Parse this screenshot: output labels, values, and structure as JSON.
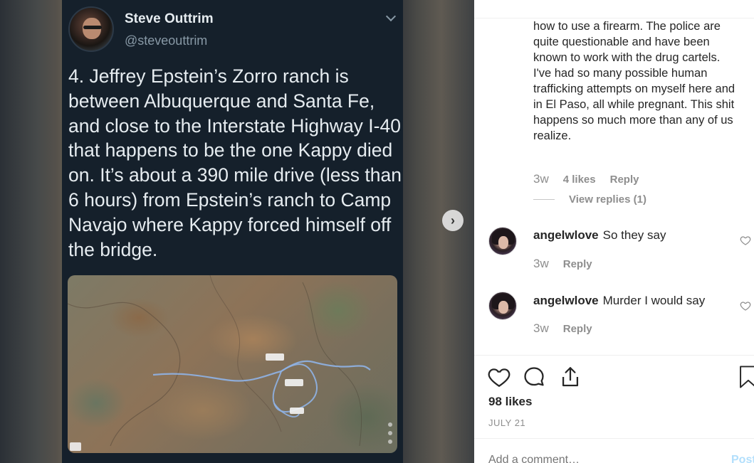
{
  "tweet": {
    "name": "Steve Outtrim",
    "handle": "@steveouttrim",
    "text": "4. Jeffrey Epstein’s Zorro ranch is between Albuquerque and Santa Fe, and close to the Interstate Highway I-40 that happens to be the one Kappy died on. It’s about a 390 mile drive (less than 6 hours) from Epstein’s ranch to Camp Navajo where Kappy forced himself off the bridge."
  },
  "media": {
    "next_icon": "chevron-right-icon",
    "map_image": "satellite-map-route"
  },
  "comments": {
    "first": {
      "text": "how to use a firearm. The police are quite questionable and have been known to work with the drug cartels. I've had so many possible human trafficking attempts on myself here and in El Paso, all while pregnant. This shit happens so much more than any of us realize.",
      "time": "3w",
      "likes": "4 likes",
      "reply": "Reply",
      "view_replies": "View replies (1)"
    },
    "second": {
      "user": "angelwlove",
      "text": "So they say",
      "time": "3w",
      "reply": "Reply"
    },
    "third": {
      "user": "angelwlove",
      "text": "Murder I would say",
      "time": "3w",
      "reply": "Reply"
    }
  },
  "post": {
    "likes": "98 likes",
    "date": "JULY 21",
    "add_comment_placeholder": "Add a comment…",
    "post_label": "Post"
  },
  "icons": {
    "like": "heart-icon",
    "comment": "comment-icon",
    "share": "share-icon",
    "save": "bookmark-icon"
  }
}
